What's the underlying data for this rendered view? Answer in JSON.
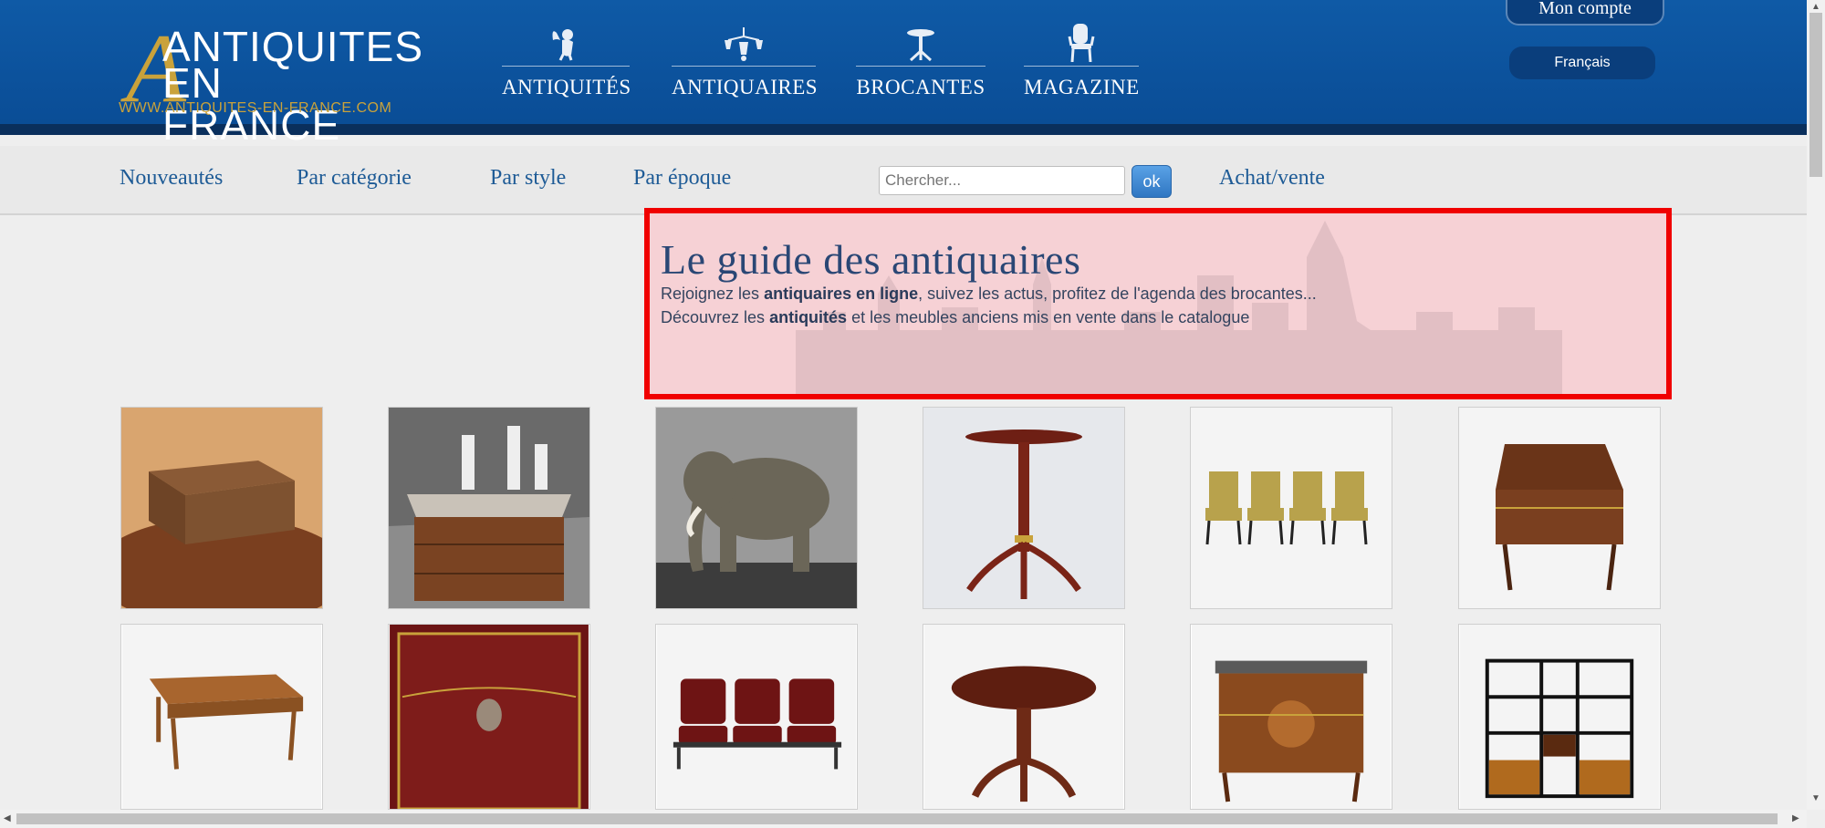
{
  "header": {
    "logo": {
      "line1": "ANTIQUITES",
      "line2": "EN FRANCE",
      "url": "WWW.ANTIQUITES-EN-FRANCE.COM",
      "accent_color": "#c9a23b"
    },
    "nav": [
      {
        "label": "ANTIQUITÉS",
        "icon": "cherub-icon"
      },
      {
        "label": "ANTIQUAIRES",
        "icon": "chandelier-icon"
      },
      {
        "label": "BROCANTES",
        "icon": "pedestal-table-icon"
      },
      {
        "label": "MAGAZINE",
        "icon": "chair-icon"
      }
    ],
    "account_label": "Mon compte",
    "language_label": "Français",
    "background_color": "#0a4d96"
  },
  "subnav": {
    "links": [
      "Nouveautés",
      "Par catégorie",
      "Par style",
      "Par époque"
    ],
    "search_placeholder": "Chercher...",
    "search_button": "ok",
    "buysell_label": "Achat/vente",
    "link_color": "#1e5b96"
  },
  "hero": {
    "title": "Le guide des antiquaires",
    "line1_pre": "Rejoignez les ",
    "line1_bold": "antiquaires en ligne",
    "line1_post": ", suivez les actus, profitez de l'agenda des brocantes...",
    "line2_pre": "Découvrez les ",
    "line2_bold": "antiquités",
    "line2_post": " et les meubles anciens mis en vente dans le catalogue",
    "highlight_border": "#f00000"
  },
  "products": [
    {
      "name": "wooden-box"
    },
    {
      "name": "marble-top-commode-with-jars"
    },
    {
      "name": "ceramic-elephant"
    },
    {
      "name": "pedestal-tripod-table"
    },
    {
      "name": "set-of-four-chairs"
    },
    {
      "name": "secretary-desk"
    },
    {
      "name": "farmhouse-table"
    },
    {
      "name": "red-leather-chest"
    },
    {
      "name": "cinema-seats"
    },
    {
      "name": "round-pedestal-table"
    },
    {
      "name": "marquetry-commode"
    },
    {
      "name": "bookcase-shelving-unit"
    }
  ]
}
